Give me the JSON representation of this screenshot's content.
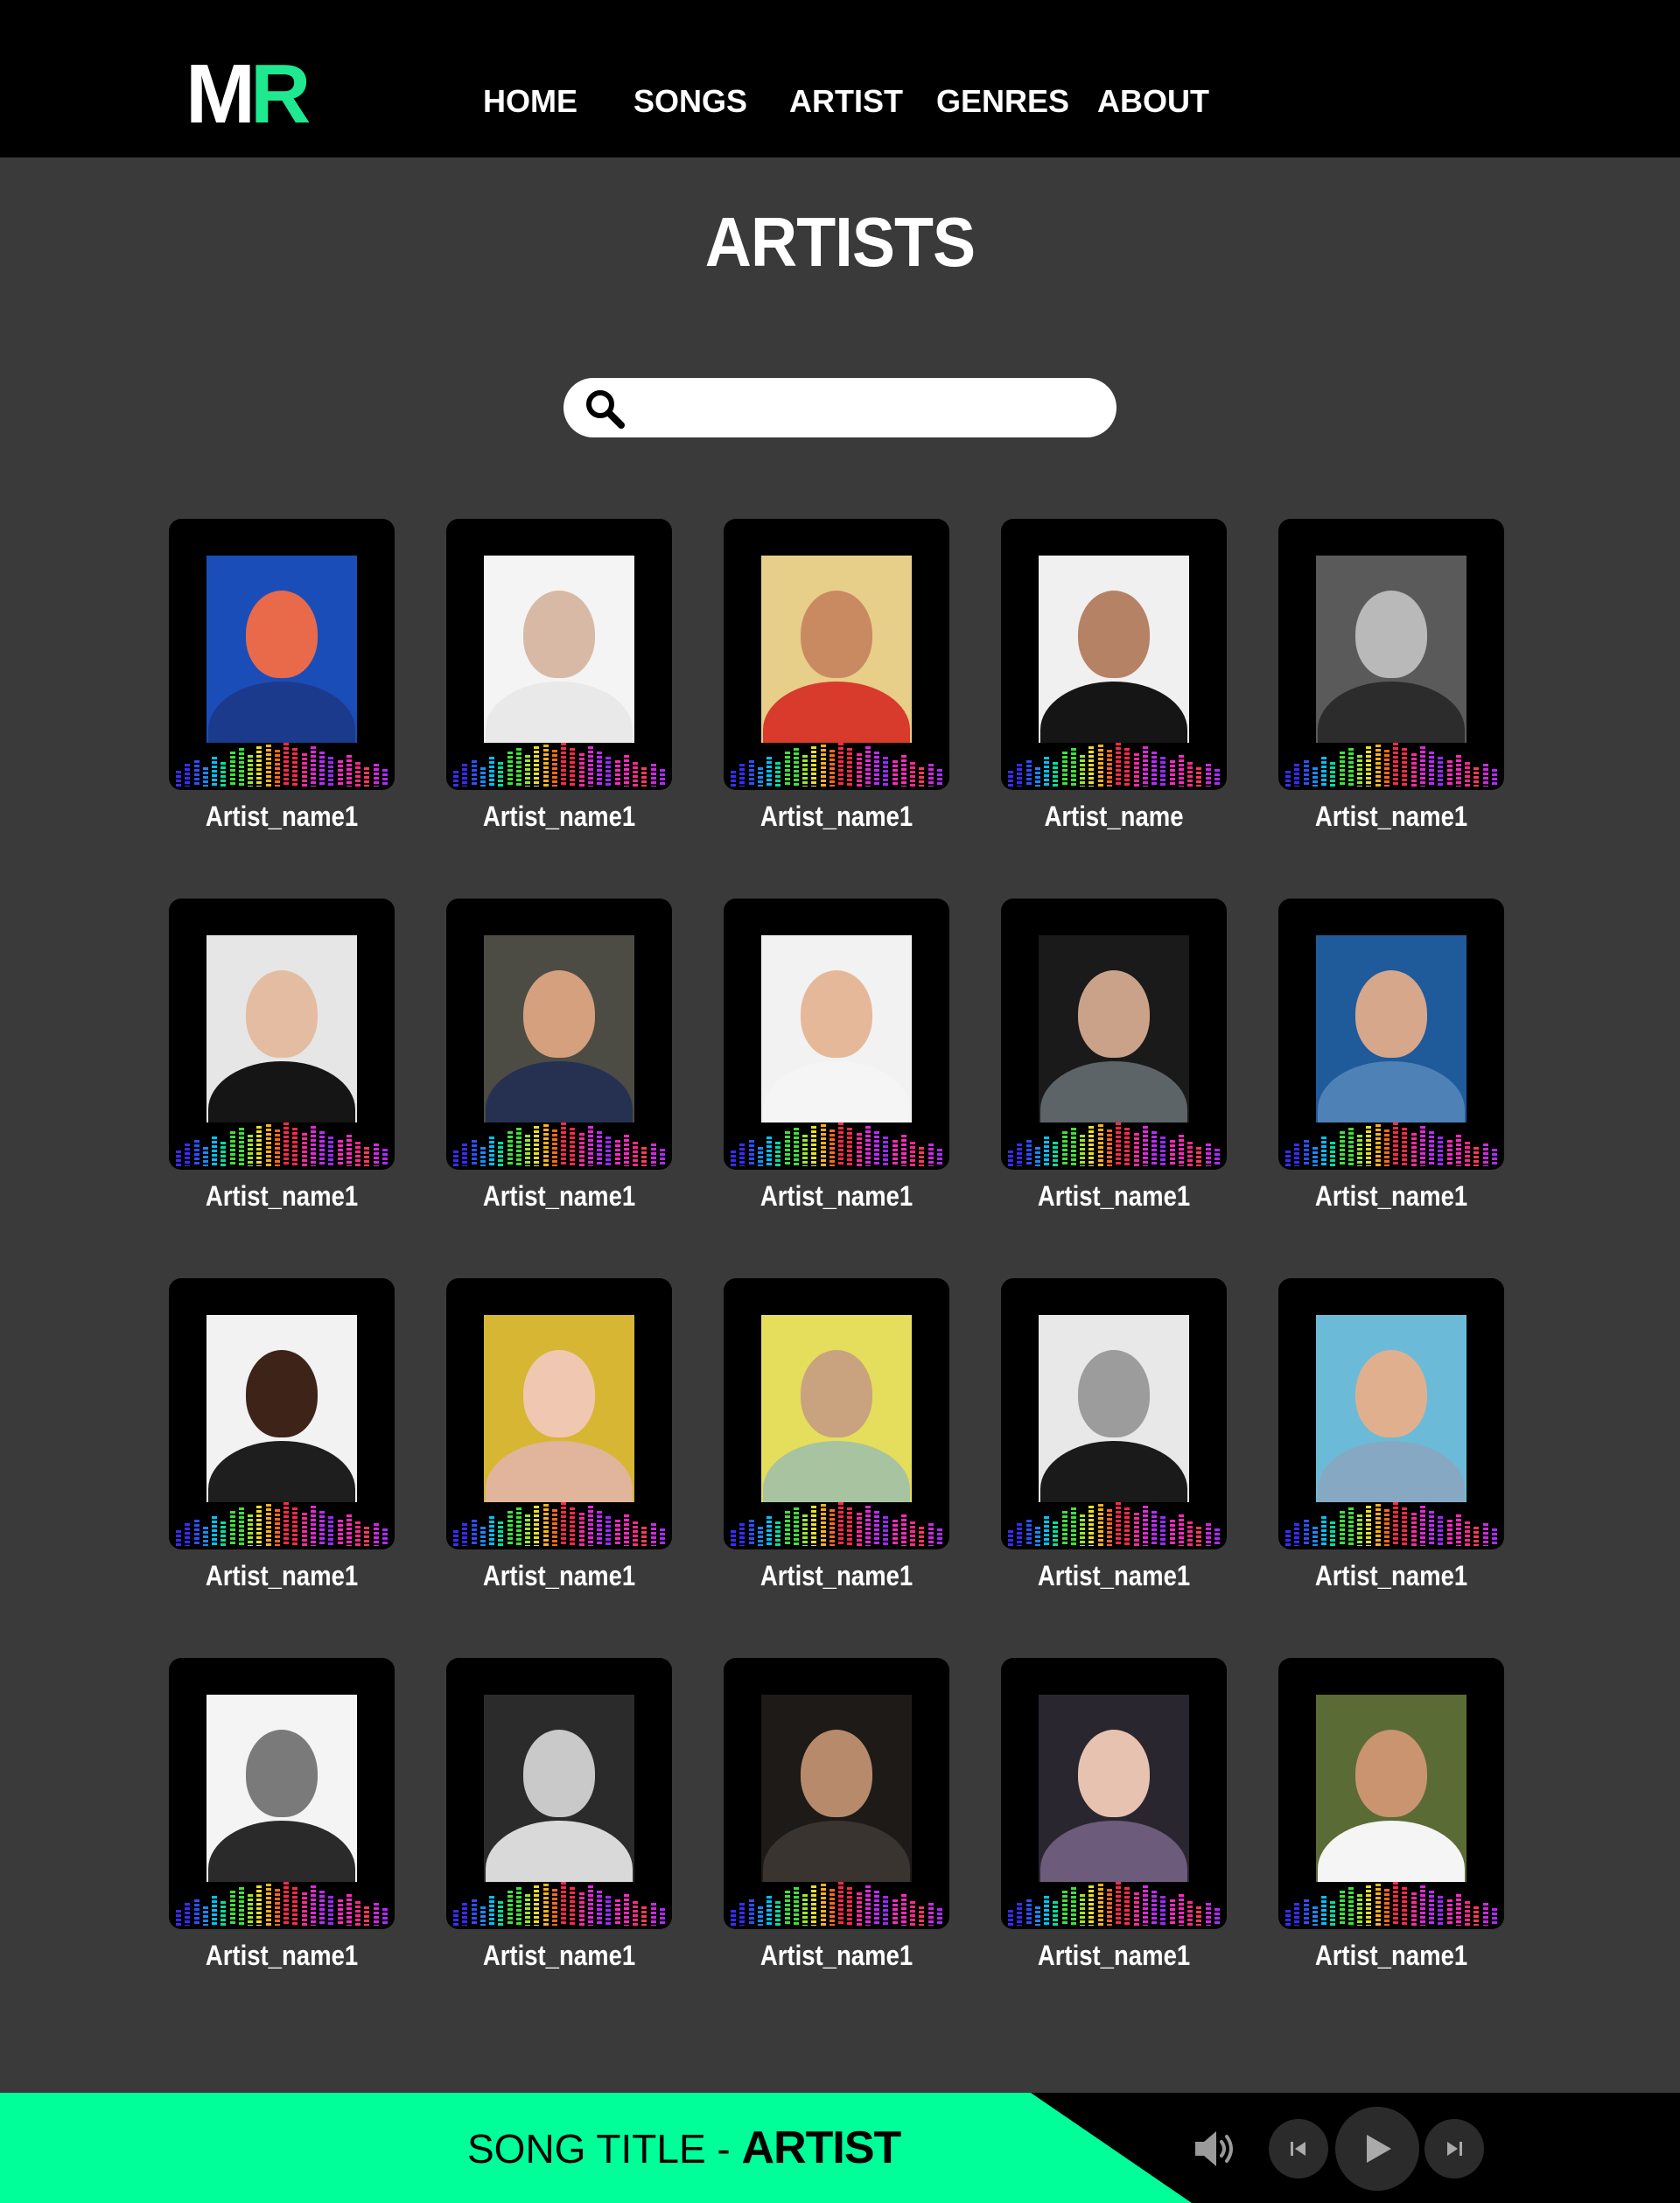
{
  "header": {
    "logo_left": "M",
    "logo_right": "R",
    "nav": [
      {
        "label": "HOME"
      },
      {
        "label": "SONGS"
      },
      {
        "label": "ARTIST"
      },
      {
        "label": "GENRES"
      },
      {
        "label": "ABOUT"
      }
    ]
  },
  "page": {
    "title": "ARTISTS"
  },
  "search": {
    "icon": "search-icon",
    "value": "",
    "placeholder": ""
  },
  "artists": [
    {
      "name": "Artist_name1"
    },
    {
      "name": "Artist_name1"
    },
    {
      "name": "Artist_name1"
    },
    {
      "name": "Artist_name"
    },
    {
      "name": "Artist_name1"
    },
    {
      "name": "Artist_name1"
    },
    {
      "name": "Artist_name1"
    },
    {
      "name": "Artist_name1"
    },
    {
      "name": "Artist_name1"
    },
    {
      "name": "Artist_name1"
    },
    {
      "name": "Artist_name1"
    },
    {
      "name": "Artist_name1"
    },
    {
      "name": "Artist_name1"
    },
    {
      "name": "Artist_name1"
    },
    {
      "name": "Artist_name1"
    },
    {
      "name": "Artist_name1"
    },
    {
      "name": "Artist_name1"
    },
    {
      "name": "Artist_name1"
    },
    {
      "name": "Artist_name1"
    },
    {
      "name": "Artist_name1"
    }
  ],
  "player": {
    "song_title": "SONG TITLE - ",
    "artist": "ARTIST",
    "icons": [
      "volume-icon",
      "previous-icon",
      "play-icon",
      "next-icon"
    ]
  },
  "colors": {
    "accent": "#1ee890",
    "player_green": "#00ff99",
    "background": "#3a3a3a",
    "header": "#000000",
    "card": "#000000"
  }
}
